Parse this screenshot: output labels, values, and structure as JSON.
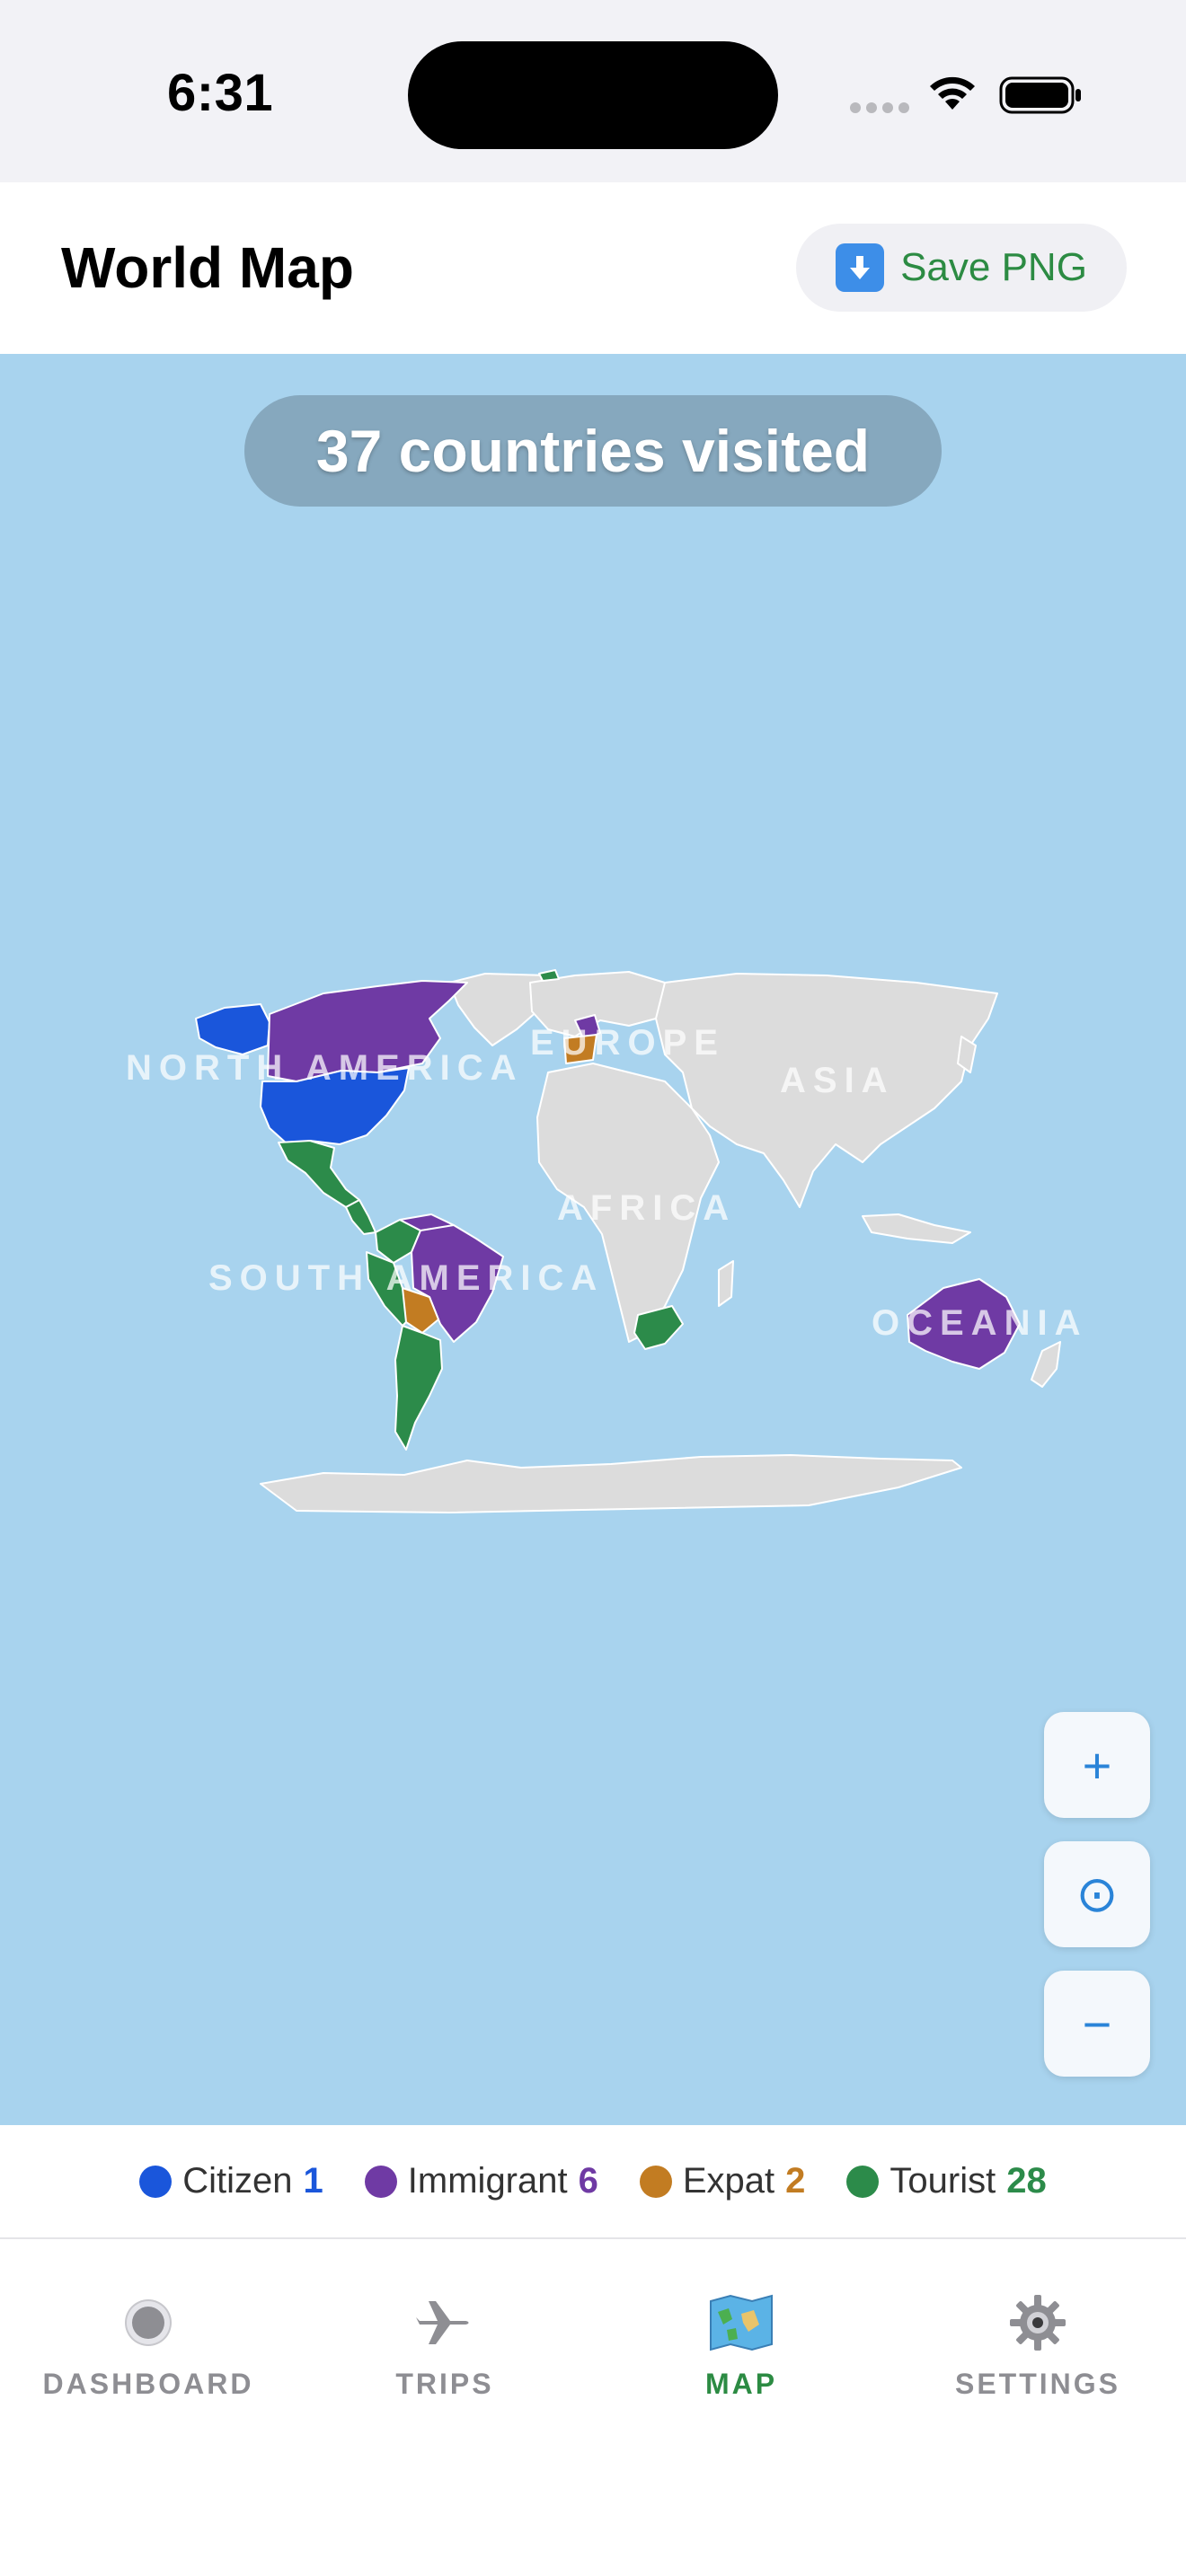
{
  "status_bar": {
    "time": "6:31"
  },
  "header": {
    "title": "World Map",
    "save_label": "Save PNG"
  },
  "map": {
    "visited_text": "37 countries visited",
    "continent_labels": {
      "north_america": "NORTH AMERICA",
      "europe": "EUROPE",
      "asia": "ASIA",
      "africa": "AFRICA",
      "south_america": "SOUTH AMERICA",
      "oceania": "OCEANIA"
    },
    "controls": {
      "zoom_in": "+",
      "recenter": "⊙",
      "zoom_out": "−"
    },
    "colors": {
      "ocean": "#a8d3ee",
      "unvisited": "#dcdcdc",
      "citizen": "#1a56db",
      "immigrant": "#6f3aa4",
      "expat": "#c27c22",
      "tourist": "#2c8b4a"
    }
  },
  "legend": [
    {
      "label": "Citizen",
      "count": "1",
      "color": "#1a56db"
    },
    {
      "label": "Immigrant",
      "count": "6",
      "color": "#6f3aa4"
    },
    {
      "label": "Expat",
      "count": "2",
      "color": "#c27c22"
    },
    {
      "label": "Tourist",
      "count": "28",
      "color": "#2c8b4a"
    }
  ],
  "tabs": [
    {
      "label": "DASHBOARD",
      "icon": "radio-button-icon",
      "active": false
    },
    {
      "label": "TRIPS",
      "icon": "airplane-icon",
      "active": false
    },
    {
      "label": "MAP",
      "icon": "world-map-icon",
      "active": true
    },
    {
      "label": "SETTINGS",
      "icon": "gear-icon",
      "active": false
    }
  ]
}
